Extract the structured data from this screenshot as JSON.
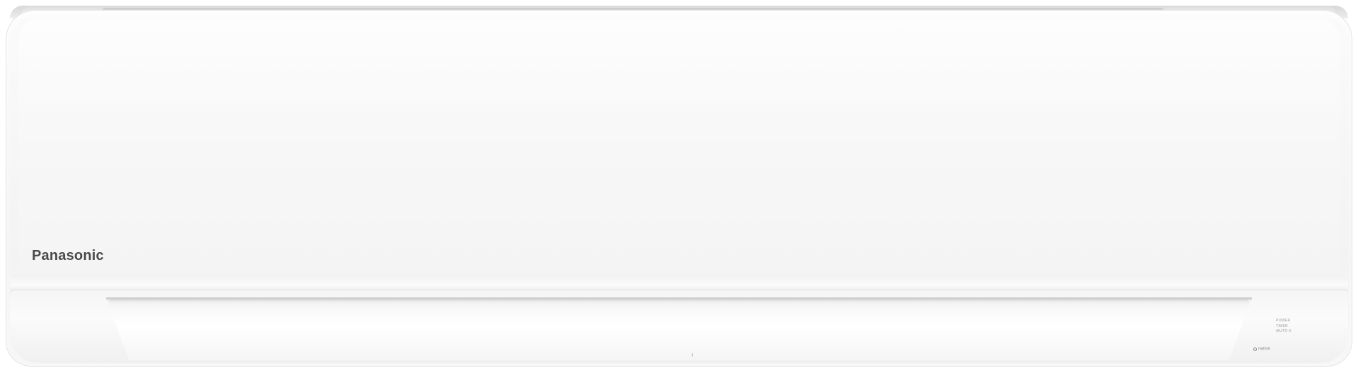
{
  "product": {
    "brand": "Panasonic",
    "indicators": [
      "POWER",
      "TIMER",
      "iAUTO-X",
      "nanoe"
    ]
  },
  "colors": {
    "body": "#f6f6f6",
    "brand_text": "#4a4a4a",
    "louver": "#ffffff"
  }
}
